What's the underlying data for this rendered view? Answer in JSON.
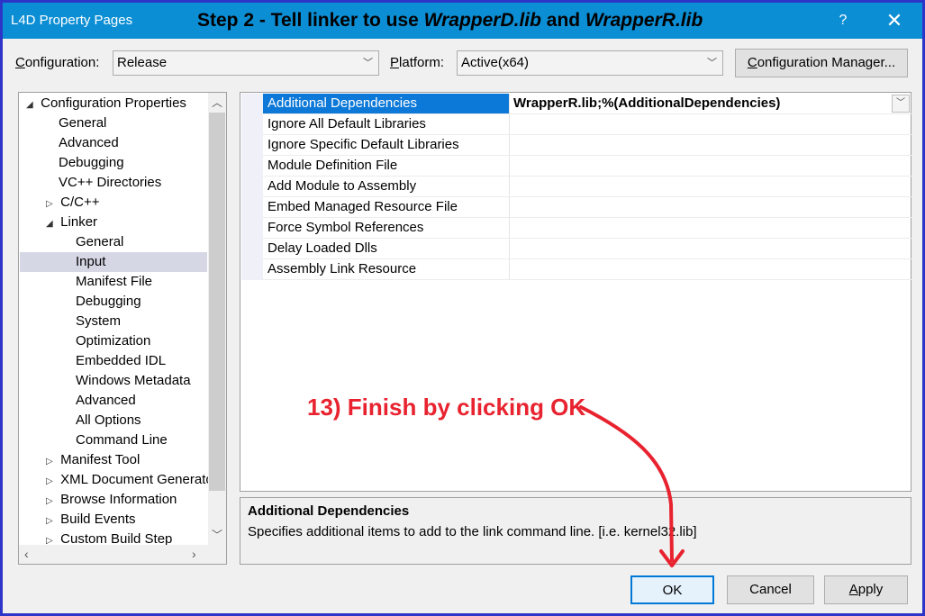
{
  "window": {
    "title": "L4D Property Pages",
    "help": "?",
    "close": "✕"
  },
  "banner": {
    "prefix": "Step 2 - Tell linker to use ",
    "lib1": "WrapperD.lib",
    "mid": " and ",
    "lib2": "WrapperR.lib"
  },
  "config": {
    "config_label_first": "C",
    "config_label_rest": "onfiguration:",
    "config_value": "Release",
    "platform_label_first": "P",
    "platform_label_rest": "latform:",
    "platform_value": "Active(x64)",
    "manager_first": "C",
    "manager_rest": "onfiguration Manager..."
  },
  "tree": {
    "items": [
      {
        "label": "Configuration Properties",
        "arrow": "◢"
      },
      {
        "label": "General"
      },
      {
        "label": "Advanced"
      },
      {
        "label": "Debugging"
      },
      {
        "label": "VC++ Directories"
      },
      {
        "label": "C/C++",
        "arrow": "▷"
      },
      {
        "label": "Linker",
        "arrow": "◢"
      },
      {
        "label": "General"
      },
      {
        "label": "Input"
      },
      {
        "label": "Manifest File"
      },
      {
        "label": "Debugging"
      },
      {
        "label": "System"
      },
      {
        "label": "Optimization"
      },
      {
        "label": "Embedded IDL"
      },
      {
        "label": "Windows Metadata"
      },
      {
        "label": "Advanced"
      },
      {
        "label": "All Options"
      },
      {
        "label": "Command Line"
      },
      {
        "label": "Manifest Tool",
        "arrow": "▷"
      },
      {
        "label": "XML Document Generator",
        "arrow": "▷"
      },
      {
        "label": "Browse Information",
        "arrow": "▷"
      },
      {
        "label": "Build Events",
        "arrow": "▷"
      },
      {
        "label": "Custom Build Step",
        "arrow": "▷"
      }
    ],
    "selected": "Input"
  },
  "properties": [
    {
      "name": "Additional Dependencies",
      "value": "WrapperR.lib;%(AdditionalDependencies)"
    },
    {
      "name": "Ignore All Default Libraries",
      "value": ""
    },
    {
      "name": "Ignore Specific Default Libraries",
      "value": ""
    },
    {
      "name": "Module Definition File",
      "value": ""
    },
    {
      "name": "Add Module to Assembly",
      "value": ""
    },
    {
      "name": "Embed Managed Resource File",
      "value": ""
    },
    {
      "name": "Force Symbol References",
      "value": ""
    },
    {
      "name": "Delay Loaded Dlls",
      "value": ""
    },
    {
      "name": "Assembly Link Resource",
      "value": ""
    }
  ],
  "description": {
    "title": "Additional Dependencies",
    "text": "Specifies additional items to add to the link command line. [i.e. kernel32.lib]"
  },
  "buttons": {
    "ok": "OK",
    "cancel": "Cancel",
    "apply_first": "A",
    "apply_rest": "pply"
  },
  "annotation": {
    "text": "13) Finish by clicking OK",
    "color": "#e8232f"
  },
  "colors": {
    "accent": "#0c8ed4",
    "selection": "#0c78d8",
    "border": "#2d35c8"
  }
}
